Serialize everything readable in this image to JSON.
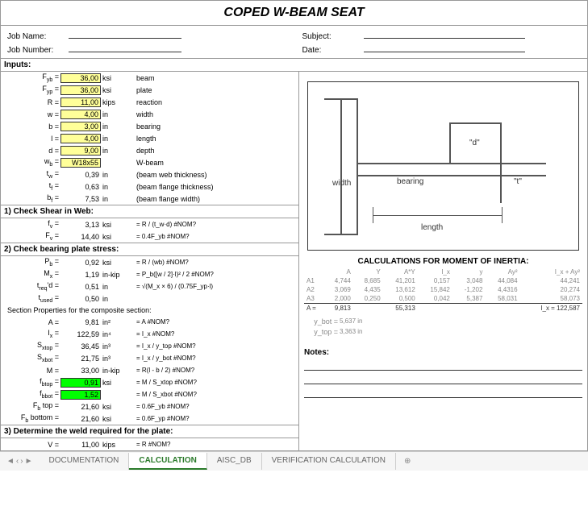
{
  "title": "COPED W-BEAM SEAT",
  "header": {
    "jobName": "Job Name:",
    "jobNumber": "Job Number:",
    "subject": "Subject:",
    "date": "Date:"
  },
  "sections": {
    "inputs": "Inputs:",
    "shear": "1) Check Shear in Web:",
    "bearing": "2)  Check bearing plate stress:",
    "sectionProps": "Section Properties for the composite section:",
    "weld": "3) Determine the weld required for the plate:"
  },
  "inputs": [
    {
      "lbl": "F_yb =",
      "val": "36,00",
      "cls": "yellow",
      "unit": "ksi",
      "desc": "beam"
    },
    {
      "lbl": "F_yp =",
      "val": "36,00",
      "cls": "yellow",
      "unit": "ksi",
      "desc": "plate"
    },
    {
      "lbl": "R =",
      "val": "11,00",
      "cls": "yellow",
      "unit": "kips",
      "desc": "reaction"
    },
    {
      "lbl": "w =",
      "val": "4,00",
      "cls": "yellow",
      "unit": "in",
      "desc": "width"
    },
    {
      "lbl": "b =",
      "val": "3,00",
      "cls": "yellow",
      "unit": "in",
      "desc": "bearing"
    },
    {
      "lbl": "l =",
      "val": "4,00",
      "cls": "yellow",
      "unit": "in",
      "desc": "length"
    },
    {
      "lbl": "d =",
      "val": "9,00",
      "cls": "yellow",
      "unit": "in",
      "desc": "depth"
    },
    {
      "lbl": "w_b =",
      "val": "W18x55",
      "cls": "yellow",
      "unit": "",
      "desc": "W-beam"
    },
    {
      "lbl": "t_w =",
      "val": "0,39",
      "cls": "",
      "unit": "in",
      "desc": "(beam web thickness)"
    },
    {
      "lbl": "t_f =",
      "val": "0,63",
      "cls": "",
      "unit": "in",
      "desc": "(beam flange thickness)"
    },
    {
      "lbl": "b_f =",
      "val": "7,53",
      "cls": "",
      "unit": "in",
      "desc": "(beam flange width)"
    }
  ],
  "shear": [
    {
      "lbl": "f_v =",
      "val": "3,13",
      "unit": "ksi",
      "f": "= R / (t_w·d) #NOM?"
    },
    {
      "lbl": "F_v =",
      "val": "14,40",
      "unit": "ksi",
      "f": "= 0.4F_yb   #NOM?"
    }
  ],
  "bearing": [
    {
      "lbl": "P_b =",
      "val": "0,92",
      "unit": "ksi",
      "f": "= R / (wb) #NOM?"
    },
    {
      "lbl": "M_x =",
      "val": "1,19",
      "unit": "in-kip",
      "f": "= P_b([w / 2]·l)² / 2  #NOM?"
    },
    {
      "lbl": "t_req'd =",
      "val": "0,51",
      "unit": "in",
      "f": "= √(M_x × 6) / (0.75F_yp·l)"
    },
    {
      "lbl": "t_used =",
      "val": "0,50",
      "unit": "in",
      "f": ""
    }
  ],
  "props": [
    {
      "lbl": "A =",
      "val": "9,81",
      "unit": "in²",
      "f": "= A        #NOM?"
    },
    {
      "lbl": "I_x =",
      "val": "122,59",
      "unit": "in⁴",
      "f": "= I_x       #NOM?"
    },
    {
      "lbl": "S_xtop =",
      "val": "36,45",
      "unit": "in³",
      "f": "= I_x / y_top #NOM?"
    },
    {
      "lbl": "S_xbot =",
      "val": "21,75",
      "unit": "in³",
      "f": "= I_x / y_bot #NOM?"
    },
    {
      "lbl": "M =",
      "val": "33,00",
      "unit": "in-kip",
      "f": "= R(l - b / 2) #NOM?"
    },
    {
      "lbl": "f_btop =",
      "val": "0,91",
      "cls": "green",
      "unit": "ksi",
      "f": "= M / S_xtop #NOM?"
    },
    {
      "lbl": "f_bbot =",
      "val": "1,52",
      "cls": "green",
      "unit": "",
      "f": "= M / S_xbot #NOM?"
    },
    {
      "lbl": "F_b top =",
      "val": "21,60",
      "unit": "ksi",
      "f": "= 0.6F_yb #NOM?"
    },
    {
      "lbl": "F_b bottom =",
      "val": "21,60",
      "unit": "ksi",
      "f": "= 0.6F_yp #NOM?"
    }
  ],
  "weld": [
    {
      "lbl": "V =",
      "val": "11,00",
      "unit": "kips",
      "f": "= R        #NOM?"
    }
  ],
  "inertia": {
    "title": "CALCULATIONS FOR MOMENT OF INERTIA:",
    "headers": [
      "",
      "A",
      "Y",
      "A*Y",
      "I_x",
      "y",
      "Ay²",
      "I_x + Ay²"
    ],
    "rows": [
      [
        "A1",
        "4,744",
        "8,685",
        "41,201",
        "0,157",
        "3,048",
        "44,084",
        "44,241"
      ],
      [
        "A2",
        "3,069",
        "4,435",
        "13,612",
        "15,842",
        "-1,202",
        "4,4316",
        "20,274"
      ],
      [
        "A3",
        "2,000",
        "0,250",
        "0,500",
        "0,042",
        "5,387",
        "58,031",
        "58,073"
      ]
    ],
    "sum": [
      "A =",
      "9,813",
      "",
      "55,313",
      "",
      "",
      "",
      "I_x = 122,587"
    ],
    "ybot": {
      "lbl": "y_bot =",
      "val": "5,637 in"
    },
    "ytop": {
      "lbl": "y_top =",
      "val": "3,363 in"
    }
  },
  "notes": "Notes:",
  "diagram": {
    "width": "width",
    "bearing": "bearing",
    "length": "length",
    "d": "\"d\"",
    "t": "\"t\""
  },
  "tabs": {
    "items": [
      "DOCUMENTATION",
      "CALCULATION",
      "AISC_DB",
      "VERIFICATION CALCULATION"
    ],
    "active": 1
  }
}
